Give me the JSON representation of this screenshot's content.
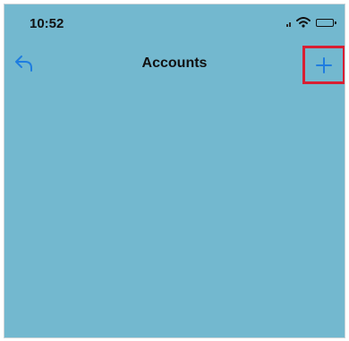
{
  "status_bar": {
    "time": "10:52"
  },
  "nav_bar": {
    "title": "Accounts",
    "back_icon": "back-arrow-icon",
    "add_icon": "plus-icon"
  },
  "colors": {
    "background": "#73b8cf",
    "accent": "#1f7de0",
    "highlight_border": "#d81f33"
  }
}
